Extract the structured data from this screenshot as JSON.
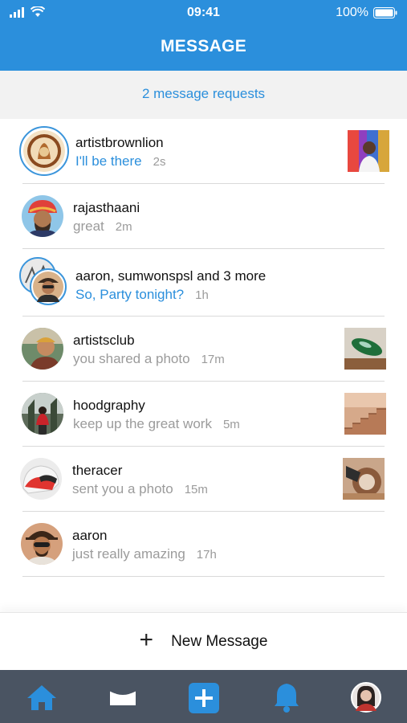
{
  "status_bar": {
    "time": "09:41",
    "battery_text": "100%"
  },
  "header": {
    "title": "MESSAGE"
  },
  "requests": {
    "label": "2 message requests"
  },
  "conversations": [
    {
      "name": "artistbrownlion",
      "preview": "I'll be there",
      "time": "2s",
      "unread": true,
      "avatar_icon": "lion-avatar",
      "thumbnail": "colorful-portrait-thumbnail"
    },
    {
      "name": "rajasthaani",
      "preview": "great",
      "time": "2m",
      "unread": false,
      "avatar_icon": "turban-man-avatar",
      "thumbnail": ""
    },
    {
      "name": "aaron, sumwonspsl and 3 more",
      "preview": "So, Party tonight?",
      "time": "1h",
      "unread": true,
      "avatar_icon": "group-avatar",
      "thumbnail": ""
    },
    {
      "name": "artistsclub",
      "preview": "you shared a photo",
      "time": "17m",
      "unread": false,
      "avatar_icon": "artist-avatar",
      "thumbnail": "green-car-thumbnail"
    },
    {
      "name": "hoodgraphy",
      "preview": "keep up the great work",
      "time": "5m",
      "unread": false,
      "avatar_icon": "red-hood-avatar",
      "thumbnail": "stairs-thumbnail"
    },
    {
      "name": "theracer",
      "preview": "sent you a photo",
      "time": "15m",
      "unread": false,
      "avatar_icon": "helmet-avatar",
      "thumbnail": "helmet-thumbnail"
    },
    {
      "name": "aaron",
      "preview": "just really amazing",
      "time": "17h",
      "unread": false,
      "avatar_icon": "sunglasses-man-avatar",
      "thumbnail": ""
    }
  ],
  "new_message": {
    "label": "New Message"
  },
  "tabbar": {
    "items": [
      "home-icon",
      "inbox-icon",
      "add-icon",
      "bell-icon",
      "profile-avatar"
    ]
  },
  "colors": {
    "accent": "#2b8fdc",
    "tabbar": "#4a5462",
    "muted": "#9b9b9b"
  }
}
